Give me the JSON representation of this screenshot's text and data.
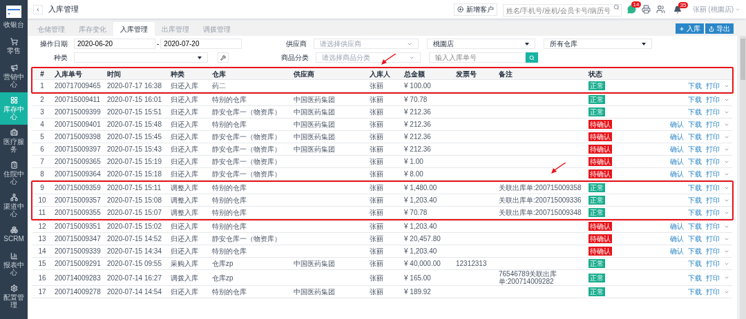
{
  "sidebar": {
    "logo_label": "收银台",
    "items": [
      {
        "label": "零售",
        "selected": false
      },
      {
        "label": "营销中心",
        "selected": false
      },
      {
        "label": "库存中心",
        "selected": true
      },
      {
        "label": "医疗服务",
        "selected": false
      },
      {
        "label": "住院中心",
        "selected": false
      },
      {
        "label": "渠道中心",
        "selected": false
      },
      {
        "label": "SCRM",
        "selected": false
      },
      {
        "label": "报表中心",
        "selected": false
      },
      {
        "label": "配置管理",
        "selected": false
      }
    ]
  },
  "header": {
    "back": "‹",
    "title": "入库管理",
    "new_customer": "新增客户",
    "search": {
      "placeholder": "姓名/手机号/座机/会员卡号/病历号"
    },
    "chat_badge": "14",
    "bell_badge": "35",
    "user": "张丽 (桃園店)"
  },
  "tabs": [
    {
      "label": "仓储管理",
      "selected": false
    },
    {
      "label": "库存变化",
      "selected": false
    },
    {
      "label": "入库管理",
      "selected": true
    },
    {
      "label": "出库管理",
      "selected": false
    },
    {
      "label": "调拨管理",
      "selected": false
    }
  ],
  "actions": [
    "入库",
    "导出"
  ],
  "filters": {
    "date_label": "操作日期",
    "date_from": "2020-06-20",
    "date_sep": "-",
    "date_to": "2020-07-20",
    "supplier_label": "供应商",
    "supplier": {
      "placeholder": "请选择供应商"
    },
    "store": "桃園店",
    "warehouse": "所有仓库",
    "type_label": "种类",
    "category_label": "商品分类",
    "category": {
      "placeholder": "请选择商品分类"
    },
    "order_no": {
      "placeholder": "输入入库单号"
    }
  },
  "table": {
    "header_highlighted": true,
    "columns": [
      "#",
      "入库单号",
      "时间",
      "种类",
      "仓库",
      "供应商",
      "入库人",
      "总金额",
      "发票号",
      "备注",
      "状态"
    ],
    "rows": [
      {
        "cells": [
          "1",
          "200717009465",
          "2020-07-17 16:38",
          "归还入库",
          "药二",
          "",
          "张丽",
          "¥ 100.00",
          "",
          ""
        ],
        "status": {
          "text": "正常",
          "color": "#1aae8f"
        },
        "actions": [
          "下载",
          "打印"
        ],
        "highlighted": true
      },
      {
        "cells": [
          "2",
          "200715009411",
          "2020-07-15 16:01",
          "归还入库",
          "特别的仓库",
          "中国医药集团",
          "张丽",
          "¥ 70.78",
          "",
          ""
        ],
        "status": {
          "text": "正常",
          "color": "#1aae8f"
        },
        "actions": [
          "下载",
          "打印"
        ],
        "highlighted": false
      },
      {
        "cells": [
          "3",
          "200715009399",
          "2020-07-15 15:51",
          "归还入库",
          "静安仓库一（物资库）",
          "中国医药集团",
          "张丽",
          "¥ 212.36",
          "",
          ""
        ],
        "status": {
          "text": "正常",
          "color": "#1aae8f"
        },
        "actions": [
          "下载",
          "打印"
        ],
        "highlighted": false
      },
      {
        "cells": [
          "4",
          "200715009401",
          "2020-07-15 15:48",
          "归还入库",
          "特别的仓库",
          "中国医药集团",
          "张丽",
          "¥ 212.36",
          "",
          ""
        ],
        "status": {
          "text": "待确认",
          "color": "#e8141b"
        },
        "actions": [
          "确认",
          "下载",
          "打印"
        ],
        "highlighted": false
      },
      {
        "cells": [
          "5",
          "200715009398",
          "2020-07-15 15:45",
          "归还入库",
          "静安仓库一（物资库）",
          "中国医药集团",
          "张丽",
          "¥ 212.36",
          "",
          ""
        ],
        "status": {
          "text": "待确认",
          "color": "#e8141b"
        },
        "actions": [
          "确认",
          "下载",
          "打印"
        ],
        "highlighted": false
      },
      {
        "cells": [
          "6",
          "200715009397",
          "2020-07-15 15:43",
          "归还入库",
          "静安仓库一（物资库）",
          "中国医药集团",
          "张丽",
          "¥ 212.36",
          "",
          ""
        ],
        "status": {
          "text": "待确认",
          "color": "#e8141b"
        },
        "actions": [
          "确认",
          "下载",
          "打印"
        ],
        "highlighted": false
      },
      {
        "cells": [
          "7",
          "200715009365",
          "2020-07-15 15:19",
          "归还入库",
          "静安仓库一（物资库）",
          "",
          "张丽",
          "¥ 1.00",
          "",
          ""
        ],
        "status": {
          "text": "待确认",
          "color": "#e8141b"
        },
        "actions": [
          "确认",
          "下载",
          "打印"
        ],
        "highlighted": false
      },
      {
        "cells": [
          "8",
          "200715009364",
          "2020-07-15 15:18",
          "归还入库",
          "静安仓库一（物资库）",
          "",
          "张丽",
          "¥ 8.00",
          "",
          ""
        ],
        "status": {
          "text": "待确认",
          "color": "#e8141b"
        },
        "actions": [
          "确认",
          "下载",
          "打印"
        ],
        "highlighted": false
      },
      {
        "cells": [
          "9",
          "200715009359",
          "2020-07-15 15:11",
          "调整入库",
          "特别的仓库",
          "",
          "张丽",
          "¥ 1,480.00",
          "",
          "关联出库单:200715009358"
        ],
        "status": {
          "text": "正常",
          "color": "#1aae8f"
        },
        "actions": [
          "下载",
          "打印"
        ],
        "highlighted": true
      },
      {
        "cells": [
          "10",
          "200715009357",
          "2020-07-15 15:08",
          "调整入库",
          "特别的仓库",
          "",
          "张丽",
          "¥ 1,203.40",
          "",
          "关联出库单:200715009336"
        ],
        "status": {
          "text": "正常",
          "color": "#1aae8f"
        },
        "actions": [
          "下载",
          "打印"
        ],
        "highlighted": true
      },
      {
        "cells": [
          "11",
          "200715009355",
          "2020-07-15 15:07",
          "调整入库",
          "特别的仓库",
          "",
          "张丽",
          "¥ 70.78",
          "",
          "关联出库单:200715009348"
        ],
        "status": {
          "text": "正常",
          "color": "#1aae8f"
        },
        "actions": [
          "下载",
          "打印"
        ],
        "highlighted": true
      },
      {
        "cells": [
          "12",
          "200715009351",
          "2020-07-15 15:02",
          "归还入库",
          "特别的仓库",
          "",
          "张丽",
          "¥ 1,203.40",
          "",
          ""
        ],
        "status": {
          "text": "待确认",
          "color": "#e8141b"
        },
        "actions": [
          "确认",
          "下载",
          "打印"
        ],
        "highlighted": false
      },
      {
        "cells": [
          "13",
          "200715009347",
          "2020-07-15 14:52",
          "归还入库",
          "静安仓库一（物资库）",
          "",
          "张丽",
          "¥ 20,457.80",
          "",
          ""
        ],
        "status": {
          "text": "待确认",
          "color": "#e8141b"
        },
        "actions": [
          "确认",
          "下载",
          "打印"
        ],
        "highlighted": false
      },
      {
        "cells": [
          "14",
          "200715009339",
          "2020-07-15 14:34",
          "归还入库",
          "特别的仓库",
          "",
          "张丽",
          "¥ 1,203.40",
          "",
          ""
        ],
        "status": {
          "text": "待确认",
          "color": "#e8141b"
        },
        "actions": [
          "确认",
          "下载",
          "打印"
        ],
        "highlighted": false
      },
      {
        "cells": [
          "15",
          "200715009291",
          "2020-07-15 09:55",
          "采购入库",
          "仓库zp",
          "中国医药集团",
          "张丽",
          "¥ 40,000.00",
          "12312313",
          ""
        ],
        "status": {
          "text": "正常",
          "color": "#1aae8f"
        },
        "actions": [
          "下载",
          "打印"
        ],
        "highlighted": false
      },
      {
        "cells": [
          "16",
          "200714009283",
          "2020-07-14 16:27",
          "调拨入库",
          "仓库zp",
          "",
          "张丽",
          "¥ 165.00",
          "",
          "76546789关联出库单:200714009282"
        ],
        "status": {
          "text": "正常",
          "color": "#1aae8f"
        },
        "actions": [
          "下载",
          "打印"
        ],
        "highlighted": false
      },
      {
        "cells": [
          "17",
          "200714009278",
          "2020-07-14 14:54",
          "归还入库",
          "特别的仓库",
          "中国医药集团",
          "张丽",
          "¥ 189.92",
          "",
          ""
        ],
        "status": {
          "text": "正常",
          "color": "#1aae8f"
        },
        "actions": [
          "下载",
          "打印"
        ],
        "highlighted": false
      }
    ]
  }
}
